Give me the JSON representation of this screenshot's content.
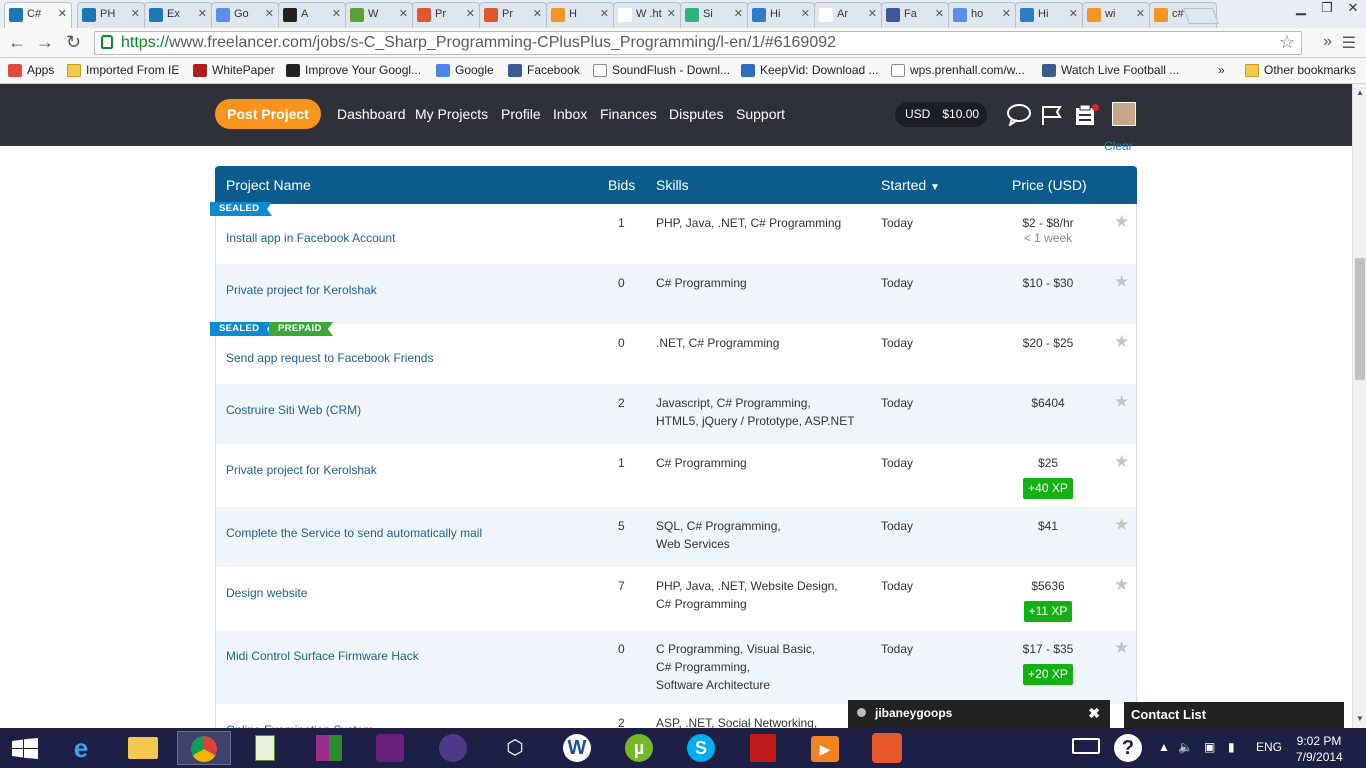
{
  "browser": {
    "tabs": [
      {
        "label": "C#",
        "favicon": "freelancer-icon",
        "color": "#1d76b5",
        "active": true
      },
      {
        "label": "PH",
        "favicon": "freelancer-icon",
        "color": "#1d76b5"
      },
      {
        "label": "Ex",
        "favicon": "freelancer-icon",
        "color": "#1d76b5"
      },
      {
        "label": "Go",
        "favicon": "translate-icon",
        "color": "#5b8ee6"
      },
      {
        "label": "A",
        "favicon": "a-icon",
        "color": "#222222"
      },
      {
        "label": "W",
        "favicon": "evernote-icon",
        "color": "#58a13b"
      },
      {
        "label": "Pr",
        "favicon": "chart-icon",
        "color": "#e0572b"
      },
      {
        "label": "Pr",
        "favicon": "chart-icon",
        "color": "#e0572b"
      },
      {
        "label": "H",
        "favicon": "rss-icon",
        "color": "#f29522"
      },
      {
        "label": "W .ht",
        "favicon": "wikipedia-icon",
        "color": "#ffffff"
      },
      {
        "label": "Si",
        "favicon": "leaf-icon",
        "color": "#2fb37b"
      },
      {
        "label": "Hi",
        "favicon": "e-icon",
        "color": "#2c7cc6"
      },
      {
        "label": "Ar",
        "favicon": "amazon-icon",
        "color": "#ffffff"
      },
      {
        "label": "Fa",
        "favicon": "facebook-icon",
        "color": "#3b5998"
      },
      {
        "label": "ho",
        "favicon": "google-icon",
        "color": "#5b8ee6"
      },
      {
        "label": "Hi",
        "favicon": "df-icon",
        "color": "#2c7cc6"
      },
      {
        "label": "wi",
        "favicon": "stack-icon",
        "color": "#f29522"
      },
      {
        "label": "c#",
        "favicon": "stack-icon",
        "color": "#f29522"
      }
    ],
    "url_scheme": "https://",
    "url_rest": "www.freelancer.com/jobs/s-C_Sharp_Programming-CPlusPlus_Programming/l-en/1/#6169092",
    "bookmarks": [
      {
        "label": "Apps",
        "icon": "apps-grid-icon"
      },
      {
        "label": "Imported From IE",
        "icon": "folder-icon"
      },
      {
        "label": "WhitePaper",
        "icon": "whitepaper-icon"
      },
      {
        "label": "Improve Your Googl...",
        "icon": "htg-icon"
      },
      {
        "label": "Google",
        "icon": "google-icon"
      },
      {
        "label": "Facebook",
        "icon": "facebook-icon"
      },
      {
        "label": "SoundFlush - Downl...",
        "icon": "page-icon"
      },
      {
        "label": "KeepVid: Download ...",
        "icon": "kv-icon"
      },
      {
        "label": "wps.prenhall.com/w...",
        "icon": "page-icon"
      },
      {
        "label": "Watch Live Football ...",
        "icon": "tv-icon"
      }
    ],
    "bookmarks_overflow": "»",
    "other_bookmarks": "Other bookmarks"
  },
  "site": {
    "post_project": "Post Project",
    "nav": [
      "Dashboard",
      "My Projects",
      "Profile",
      "Inbox",
      "Finances",
      "Disputes",
      "Support"
    ],
    "currency": "USD",
    "balance": "$10.00",
    "clear": "Clear"
  },
  "table": {
    "headers": {
      "project_name": "Project Name",
      "bids": "Bids",
      "skills": "Skills",
      "started": "Started",
      "price": "Price (USD)"
    },
    "rows": [
      {
        "name": "Install app in Facebook Account",
        "bids": "1",
        "skills": [
          "PHP,  Java,  .NET,  C# Programming"
        ],
        "started": "Today",
        "price": "$2 - $8/hr",
        "price_sub": "< 1 week",
        "xp": "",
        "tags": [
          "SEALED"
        ]
      },
      {
        "name": "Private project for Kerolshak",
        "bids": "0",
        "skills": [
          "C# Programming"
        ],
        "started": "Today",
        "price": "$10 - $30",
        "price_sub": "",
        "xp": "",
        "tags": []
      },
      {
        "name": "Send app request to Facebook Friends",
        "bids": "0",
        "skills": [
          ".NET,  C# Programming"
        ],
        "started": "Today",
        "price": "$20 - $25",
        "price_sub": "",
        "xp": "",
        "tags": [
          "SEALED",
          "PREPAID"
        ]
      },
      {
        "name": "Costruire Siti Web (CRM)",
        "bids": "2",
        "skills": [
          "Javascript,  C# Programming,",
          "HTML5,  jQuery / Prototype,  ASP.NET"
        ],
        "started": "Today",
        "price": "$6404",
        "price_sub": "",
        "xp": "",
        "tags": []
      },
      {
        "name": "Private project for Kerolshak",
        "bids": "1",
        "skills": [
          "C# Programming"
        ],
        "started": "Today",
        "price": "$25",
        "price_sub": "",
        "xp": "+40 XP",
        "tags": []
      },
      {
        "name": "Complete the Service to send automatically mail",
        "bids": "5",
        "skills": [
          "SQL,  C# Programming,",
          "Web Services"
        ],
        "started": "Today",
        "price": "$41",
        "price_sub": "",
        "xp": "",
        "tags": []
      },
      {
        "name": "Design website",
        "bids": "7",
        "skills": [
          "PHP,  Java,  .NET,  Website Design,",
          "C# Programming"
        ],
        "started": "Today",
        "price": "$5636",
        "price_sub": "",
        "xp": "+11 XP",
        "tags": []
      },
      {
        "name": "Midi Control Surface Firmware Hack",
        "bids": "0",
        "skills": [
          "C Programming,  Visual Basic,",
          "C# Programming,",
          "Software Architecture"
        ],
        "started": "Today",
        "price": "$17 - $35",
        "price_sub": "",
        "xp": "+20 XP",
        "tags": []
      },
      {
        "name": "Online Examination System",
        "bids": "2",
        "skills": [
          "ASP,  .NET,  Social Networking,"
        ],
        "started": "",
        "price": "",
        "price_sub": "",
        "xp": "",
        "tags": []
      }
    ]
  },
  "chat": {
    "username": "jibaneygoops",
    "contact_list": "Contact List"
  },
  "taskbar": {
    "language": "ENG",
    "time": "9:02 PM",
    "date": "7/9/2014"
  }
}
